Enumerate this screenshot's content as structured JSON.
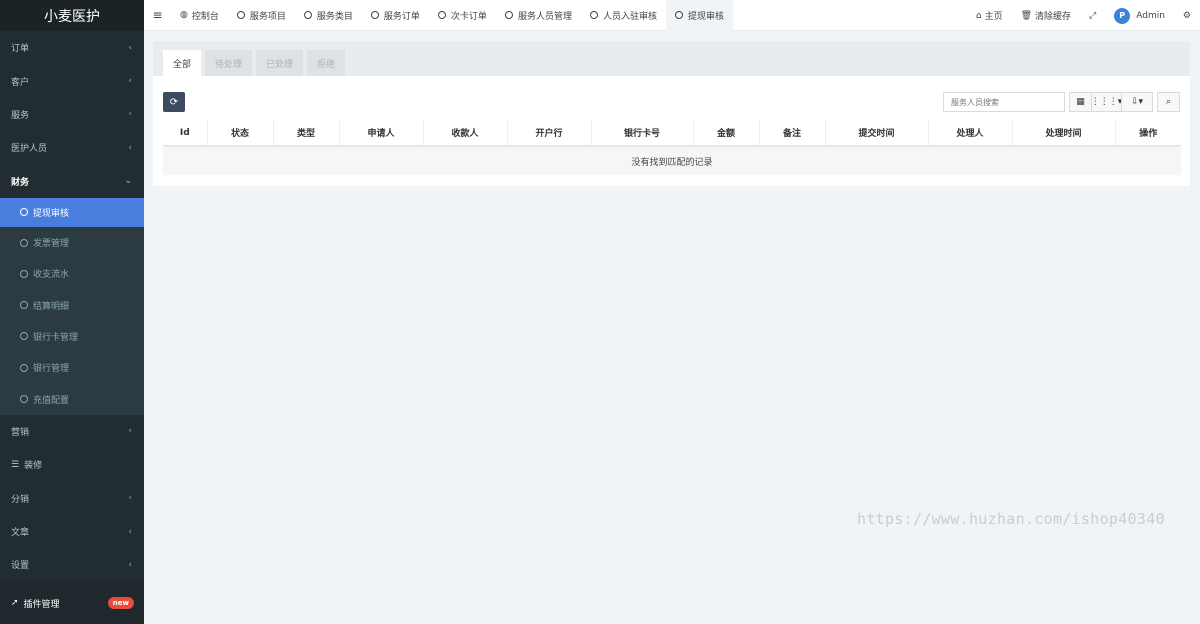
{
  "brand": "小麦医护",
  "sidebar": {
    "items": [
      {
        "label": "订单",
        "chevron": "‹"
      },
      {
        "label": "客户",
        "chevron": "‹"
      },
      {
        "label": "服务",
        "chevron": "‹"
      },
      {
        "label": "医护人员",
        "chevron": "‹"
      },
      {
        "label": "财务",
        "chevron": "⌄"
      }
    ],
    "sub_items": [
      "提现审核",
      "发票管理",
      "收支流水",
      "结算明细",
      "银行卡管理",
      "银行管理",
      "充值配置"
    ],
    "items_after": [
      {
        "label": "营销",
        "chevron": "‹"
      },
      {
        "label": "装修",
        "chevron": ""
      },
      {
        "label": "分销",
        "chevron": "‹"
      },
      {
        "label": "文章",
        "chevron": "‹"
      },
      {
        "label": "设置",
        "chevron": "‹"
      }
    ],
    "plugin_label": "插件管理",
    "plugin_badge": "new"
  },
  "topbar": {
    "tabs": [
      "控制台",
      "服务项目",
      "服务类目",
      "服务订单",
      "次卡订单",
      "服务人员管理",
      "人员入驻审核",
      "提现审核"
    ],
    "home": "主页",
    "clear_cache": "清除缓存",
    "user": "Admin",
    "avatar_text": "P"
  },
  "panel": {
    "tabs": [
      "全部",
      "待处理",
      "已处理",
      "拒绝"
    ],
    "search_placeholder": "服务人员搜索",
    "columns": [
      "Id",
      "状态",
      "类型",
      "申请人",
      "收款人",
      "开户行",
      "银行卡号",
      "金额",
      "备注",
      "提交时间",
      "处理人",
      "处理时间",
      "操作"
    ],
    "empty_text": "没有找到匹配的记录"
  },
  "watermark": "https://www.huzhan.com/ishop40340"
}
